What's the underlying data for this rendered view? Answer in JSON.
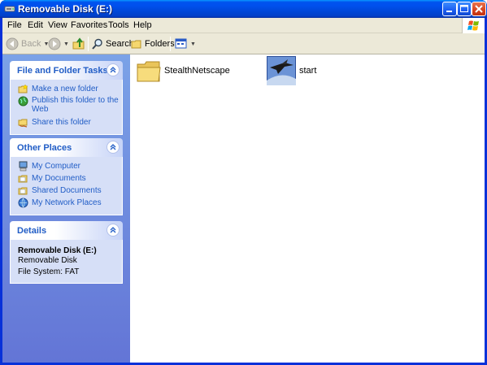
{
  "window": {
    "title": "Removable Disk (E:)"
  },
  "menu": [
    "File",
    "Edit",
    "View",
    "Favorites",
    "Tools",
    "Help"
  ],
  "toolbar": {
    "back_label": "Back",
    "search_label": "Search",
    "folders_label": "Folders"
  },
  "taskpane": {
    "file_tasks": {
      "title": "File and Folder Tasks",
      "items": [
        "Make a new folder",
        "Publish this folder to the Web",
        "Share this folder"
      ]
    },
    "other_places": {
      "title": "Other Places",
      "items": [
        "My Computer",
        "My Documents",
        "Shared Documents",
        "My Network Places"
      ]
    },
    "details": {
      "title": "Details",
      "name": "Removable Disk (E:)",
      "type": "Removable Disk",
      "filesystem": "File System: FAT"
    }
  },
  "files": [
    {
      "name": "StealthNetscape",
      "icon": "folder-icon"
    },
    {
      "name": "start",
      "icon": "stealth-jet-icon"
    }
  ],
  "colors": {
    "titlebar_blue": "#0050ee",
    "taskpane_link": "#215dc6",
    "taskpane_bg": "#6375d6"
  }
}
